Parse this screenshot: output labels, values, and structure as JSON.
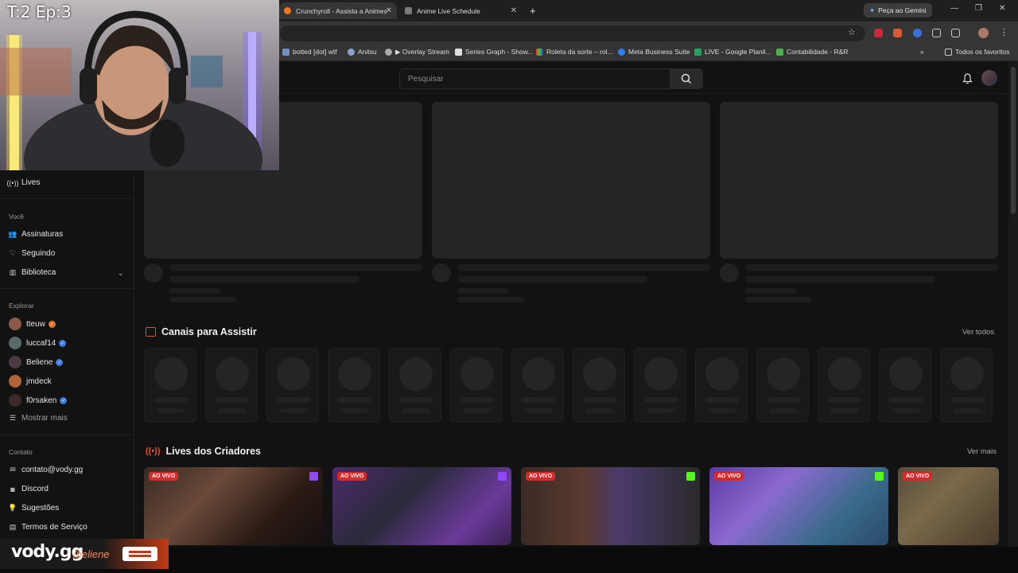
{
  "browser": {
    "tabs": [
      {
        "label": "Crunchyroll - Assista a Animes",
        "active": true
      },
      {
        "label": "Anime Live Schedule",
        "active": false
      }
    ],
    "new_tab": "+",
    "gemini_label": "Peça ao Gemini",
    "bookmarks": [
      "botted [dot] wtf",
      "Anitsu",
      "▶ Overlay Stream",
      "Series Graph - Show...",
      "Roleta da sorte – rol...",
      "Meta Business Suite",
      "LIVE - Google Planil...",
      "Contabilidade - R&R"
    ],
    "bookmarks_more": "»",
    "all_favorites": "Todos os favoritos"
  },
  "webcam": {
    "title": "T:2 Ep:3"
  },
  "search": {
    "placeholder": "Pesquisar"
  },
  "sidebar": {
    "lives": "Lives",
    "voce_heading": "Você",
    "voce_items": [
      "Assinaturas",
      "Seguindo",
      "Biblioteca"
    ],
    "explorar_heading": "Explorar",
    "channels": [
      {
        "name": "tteuw",
        "verified_color": "#e8722a"
      },
      {
        "name": "luccaf14",
        "verified_color": "#3d7be0"
      },
      {
        "name": "Beliene",
        "verified_color": "#3d7be0"
      },
      {
        "name": "jmdeck",
        "verified_color": ""
      },
      {
        "name": "f0rsaken",
        "verified_color": "#3d7be0"
      }
    ],
    "show_more": "Mostrar mais",
    "contato_heading": "Contato",
    "contato_items": [
      "contato@vody.gg",
      "Discord",
      "Sugestões",
      "Termos de Serviço"
    ]
  },
  "sections": {
    "canais_title": "Canais para Assistir",
    "canais_link": "Ver todos",
    "lives_title": "Lives dos Criadores",
    "lives_link": "Ver mais"
  },
  "live_cards": [
    {
      "badge": "AO VIVO",
      "platform": "twitch"
    },
    {
      "badge": "AO VIVO",
      "platform": "twitch"
    },
    {
      "badge": "AO VIVO",
      "platform": "kick"
    },
    {
      "badge": "AO VIVO",
      "platform": "kick"
    },
    {
      "badge": "AO VIVO",
      "platform": ""
    }
  ],
  "overlay": {
    "brand": "vody.gg",
    "channel": "/beliene"
  },
  "colors": {
    "accent": "#e1532a",
    "live": "#d72a2a",
    "verified": "#3d7be0",
    "twitch": "#9146ff",
    "kick": "#53fc18"
  }
}
